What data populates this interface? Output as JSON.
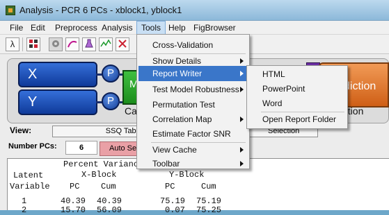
{
  "window": {
    "title": "Analysis - PCR 6 PCs - xblock1, yblock1",
    "icon": "app-icon"
  },
  "menubar": {
    "items": [
      "File",
      "Edit",
      "Preprocess",
      "Analysis",
      "Tools",
      "Help",
      "FigBrowser"
    ],
    "active": "Tools"
  },
  "toolbar": {
    "icons": [
      "lambda-icon",
      "grid-icon",
      "gear-icon",
      "lambda-curve-icon",
      "flask-icon",
      "line-chart-icon",
      "cross-chart-icon"
    ],
    "lambda_glyph": "λ"
  },
  "flow": {
    "x_label": "X",
    "y_label": "Y",
    "p_label": "P",
    "model_label": "M",
    "cal_label": "Cal",
    "prediction_label": "diction",
    "ation_label": "ation"
  },
  "view": {
    "label": "View:",
    "ssq_label": "SSQ Table",
    "selection_label": "Selection"
  },
  "pcs": {
    "label": "Number PCs:",
    "value": "6",
    "autoselect_label": "Auto Se"
  },
  "variance_table": {
    "title": "Percent Variance C",
    "xblock": "X-Block",
    "yblock": "Y-Block",
    "latent": "Latent",
    "variable": "Variable",
    "headers": [
      "PC",
      "Cum",
      "PC",
      "Cum"
    ],
    "rows": [
      {
        "id": "1",
        "cells": [
          "40.39",
          "40.39",
          "75.19",
          "75.19"
        ]
      },
      {
        "id": "2",
        "cells": [
          "15.70",
          "56.09",
          "0.07",
          "75.25"
        ]
      }
    ]
  },
  "tools_menu": {
    "items": [
      {
        "label": "Cross-Validation",
        "submenu": false
      },
      {
        "label": "Show Details",
        "submenu": true
      },
      {
        "label": "Report Writer",
        "submenu": true,
        "highlighted": true
      },
      {
        "label": "Test Model Robustness",
        "submenu": true
      },
      {
        "label": "Permutation Test",
        "submenu": false
      },
      {
        "label": "Correlation Map",
        "submenu": true
      },
      {
        "label": "Estimate Factor SNR",
        "submenu": false
      },
      {
        "label": "View Cache",
        "submenu": true
      },
      {
        "label": "Toolbar",
        "submenu": true
      }
    ]
  },
  "report_writer_submenu": {
    "items": [
      "HTML",
      "PowerPoint",
      "Word",
      "Open Report Folder"
    ]
  },
  "colors": {
    "menu_highlight": "#3a76c9",
    "block_blue": "#1f4fb8",
    "model_green": "#2aa22a",
    "prediction_orange": "#e07b32",
    "autoselect_pink": "#e9a0a6"
  }
}
